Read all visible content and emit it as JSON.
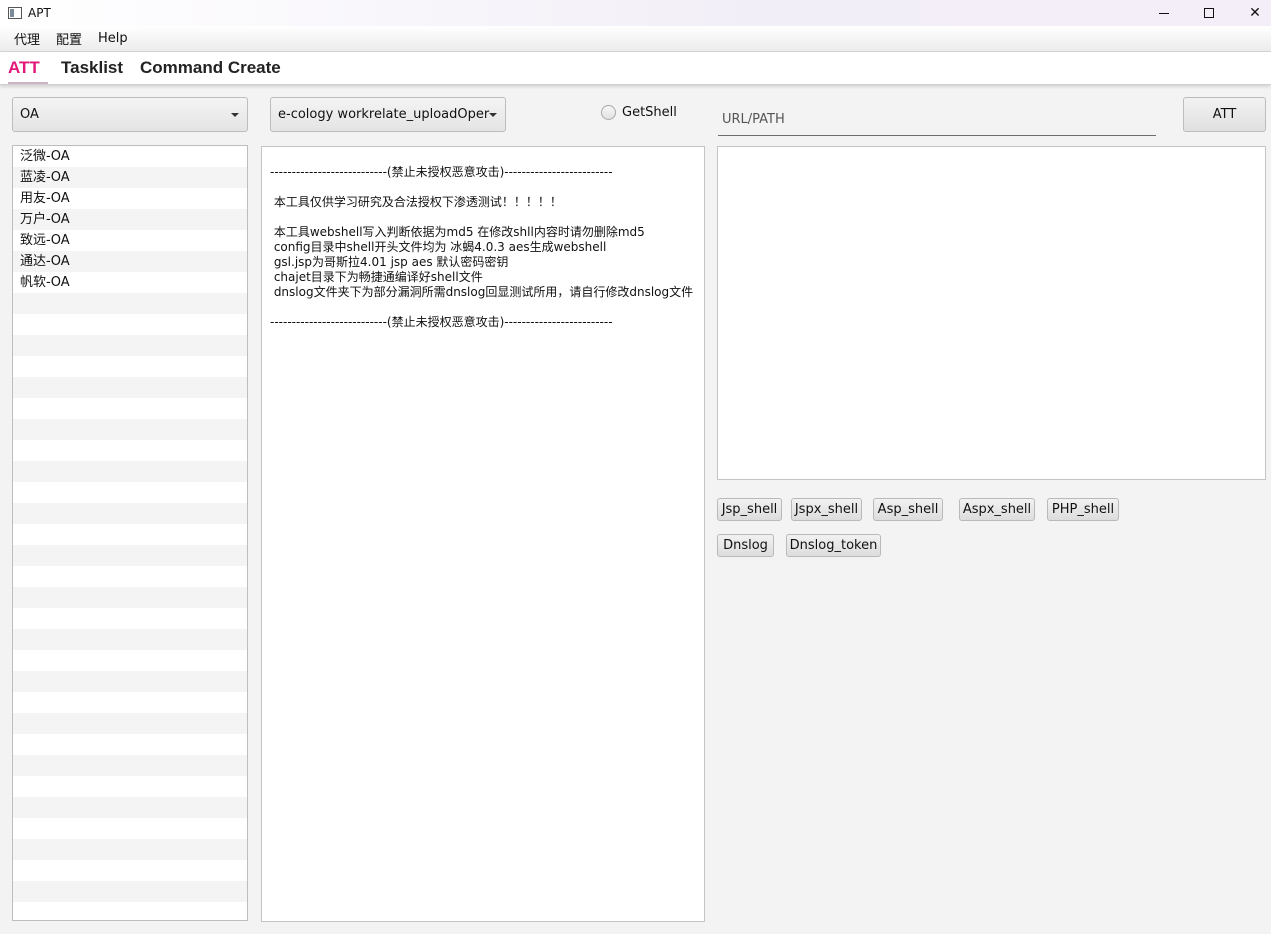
{
  "window": {
    "title": "APT",
    "minimize_icon": "minimize-icon",
    "maximize_icon": "maximize-icon",
    "close_label": "✕"
  },
  "menu": {
    "items": [
      "代理",
      "配置",
      "Help"
    ]
  },
  "tabs": [
    {
      "label": "ATT",
      "active": true
    },
    {
      "label": "Tasklist",
      "active": false
    },
    {
      "label": "Command Create",
      "active": false
    }
  ],
  "colors": {
    "active_tab": "#e3177a"
  },
  "att": {
    "category_select": "OA",
    "exploit_select": "e-cology workrelate_uploadOperati...",
    "getshell_label": "GetShell",
    "getshell_checked": false,
    "url_placeholder": "URL/PATH",
    "url_value": "",
    "att_button": "ATT",
    "categories": [
      "泛微-OA",
      "蓝凌-OA",
      "用友-OA",
      "万户-OA",
      "致远-OA",
      "通达-OA",
      "帆软-OA"
    ],
    "info_lines": [
      "---------------------------(禁止未授权恶意攻击)-------------------------",
      "",
      " 本工具仅供学习研究及合法授权下渗透测试！！！！！",
      "",
      " 本工具webshell写入判断依据为md5 在修改shll内容时请勿删除md5",
      " config目录中shell开头文件均为 冰蝎4.0.3 aes生成webshell",
      " gsl.jsp为哥斯拉4.01 jsp aes 默认密码密钥",
      " chajet目录下为畅捷通编译好shell文件",
      " dnslog文件夹下为部分漏洞所需dnslog回显测试所用，请自行修改dnslog文件",
      "",
      "---------------------------(禁止未授权恶意攻击)-------------------------"
    ],
    "shell_buttons": [
      "Jsp_shell",
      "Jspx_shell",
      "Asp_shell",
      "Aspx_shell",
      "PHP_shell"
    ],
    "dns_buttons": [
      "Dnslog",
      "Dnslog_token"
    ]
  }
}
